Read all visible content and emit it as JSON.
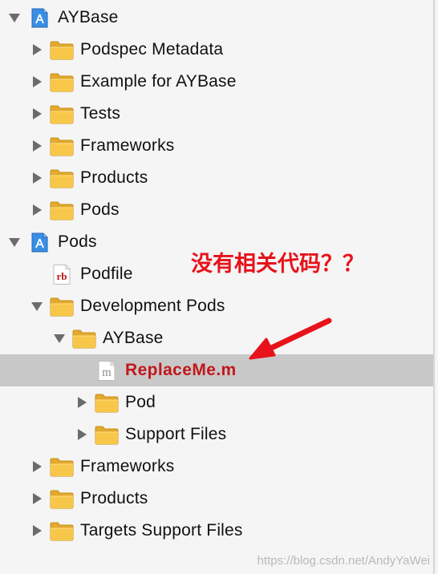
{
  "tree": {
    "items": [
      {
        "label": "AYBase",
        "icon": "project-icon",
        "disclosure": "expanded",
        "depth": 0
      },
      {
        "label": "Podspec Metadata",
        "icon": "folder-icon",
        "disclosure": "collapsed",
        "depth": 1
      },
      {
        "label": "Example for AYBase",
        "icon": "folder-icon",
        "disclosure": "collapsed",
        "depth": 1
      },
      {
        "label": "Tests",
        "icon": "folder-icon",
        "disclosure": "collapsed",
        "depth": 1
      },
      {
        "label": "Frameworks",
        "icon": "folder-icon",
        "disclosure": "collapsed",
        "depth": 1
      },
      {
        "label": "Products",
        "icon": "folder-icon",
        "disclosure": "collapsed",
        "depth": 1
      },
      {
        "label": "Pods",
        "icon": "folder-icon",
        "disclosure": "collapsed",
        "depth": 1
      },
      {
        "label": "Pods",
        "icon": "project-icon",
        "disclosure": "expanded",
        "depth": 0
      },
      {
        "label": "Podfile",
        "icon": "ruby-file-icon",
        "disclosure": "none",
        "depth": 1
      },
      {
        "label": "Development Pods",
        "icon": "folder-icon",
        "disclosure": "expanded",
        "depth": 1
      },
      {
        "label": "AYBase",
        "icon": "folder-icon",
        "disclosure": "expanded",
        "depth": 2
      },
      {
        "label": "ReplaceMe.m",
        "icon": "objc-file-icon",
        "disclosure": "none",
        "depth": 3,
        "selected": true
      },
      {
        "label": "Pod",
        "icon": "folder-icon",
        "disclosure": "collapsed",
        "depth": 3
      },
      {
        "label": "Support Files",
        "icon": "folder-icon",
        "disclosure": "collapsed",
        "depth": 3
      },
      {
        "label": "Frameworks",
        "icon": "folder-icon",
        "disclosure": "collapsed",
        "depth": 1
      },
      {
        "label": "Products",
        "icon": "folder-icon",
        "disclosure": "collapsed",
        "depth": 1
      },
      {
        "label": "Targets Support Files",
        "icon": "folder-icon",
        "disclosure": "collapsed",
        "depth": 1
      }
    ]
  },
  "annotation": {
    "text": "没有相关代码？？",
    "color": "#e8121a"
  },
  "watermark": "https://blog.csdn.net/AndyYaWei",
  "colors": {
    "background": "#f5f5f5",
    "selection": "#c8c8c8",
    "selected_text": "#c2171b",
    "folder_fill": "#f8c74a",
    "project_blue": "#3a8ee6"
  },
  "icons": {
    "m_letter": "m",
    "rb_letters": "rb"
  }
}
